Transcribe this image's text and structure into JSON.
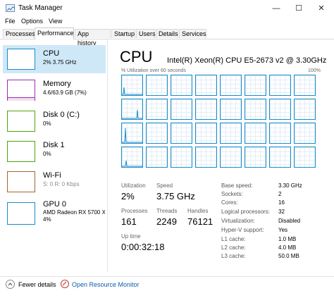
{
  "window": {
    "title": "Task Manager",
    "min": "—",
    "max": "☐",
    "close": "✕"
  },
  "menu": [
    "File",
    "Options",
    "View"
  ],
  "tabs": [
    "Processes",
    "Performance",
    "App history",
    "Startup",
    "Users",
    "Details",
    "Services"
  ],
  "sidebar": [
    {
      "title": "CPU",
      "sub": "2% 3.75 GHz",
      "color": "#1b8bc9"
    },
    {
      "title": "Memory",
      "sub": "4.6/63.9 GB (7%)",
      "color": "#9b2fae"
    },
    {
      "title": "Disk 0 (C:)",
      "sub": "0%",
      "color": "#4da60c"
    },
    {
      "title": "Disk 1",
      "sub": "0%",
      "color": "#4da60c"
    },
    {
      "title": "Wi-Fi",
      "sub": "S: 0 R: 0 Kbps",
      "color": "#a7642d"
    },
    {
      "title": "GPU 0",
      "sub": "AMD Radeon RX 5700 X",
      "sub2": "4%",
      "color": "#1b8bc9"
    }
  ],
  "main": {
    "title": "CPU",
    "model": "Intel(R) Xeon(R) CPU E5-2673 v2 @ 3.30GHz",
    "util_label": "% Utilization over 60 seconds",
    "util_max": "100%",
    "stats": {
      "utilization_label": "Utilization",
      "utilization": "2%",
      "speed_label": "Speed",
      "speed": "3.75 GHz",
      "processes_label": "Processes",
      "processes": "161",
      "threads_label": "Threads",
      "threads": "2249",
      "handles_label": "Handles",
      "handles": "76121",
      "uptime_label": "Up time",
      "uptime": "0:00:32:18"
    },
    "details": [
      {
        "label": "Base speed:",
        "value": "3.30 GHz"
      },
      {
        "label": "Sockets:",
        "value": "2"
      },
      {
        "label": "Cores:",
        "value": "16"
      },
      {
        "label": "Logical processors:",
        "value": "32"
      },
      {
        "label": "Virtualization:",
        "value": "Disabled"
      },
      {
        "label": "Hyper-V support:",
        "value": "Yes"
      },
      {
        "label": "L1 cache:",
        "value": "1.0 MB"
      },
      {
        "label": "L2 cache:",
        "value": "4.0 MB"
      },
      {
        "label": "L3 cache:",
        "value": "50.0 MB"
      }
    ]
  },
  "footer": {
    "fewer_details": "Fewer details",
    "resource_monitor": "Open Resource Monitor"
  },
  "colors": {
    "accent": "#1b8bc9",
    "selected_bg": "#cfe8f7",
    "link": "#0b5ea8"
  }
}
